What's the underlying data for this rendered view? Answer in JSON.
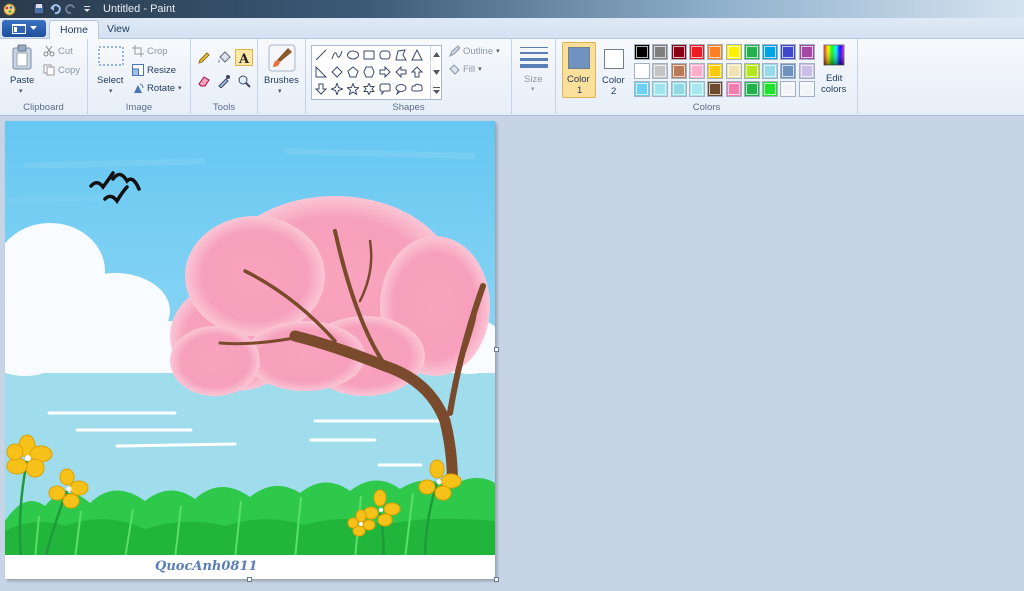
{
  "window": {
    "title": "Untitled - Paint"
  },
  "tabs": [
    {
      "label": "Home"
    },
    {
      "label": "View"
    }
  ],
  "clipboard": {
    "paste": "Paste",
    "cut": "Cut",
    "copy": "Copy",
    "group": "Clipboard"
  },
  "image": {
    "select": "Select",
    "crop": "Crop",
    "resize": "Resize",
    "rotate": "Rotate",
    "group": "Image"
  },
  "tools": {
    "group": "Tools"
  },
  "brushes": {
    "label": "Brushes"
  },
  "shapes": {
    "outline": "Outline",
    "fill": "Fill",
    "group": "Shapes"
  },
  "size": {
    "label": "Size"
  },
  "colors": {
    "color1_label": "Color",
    "color1_num": "1",
    "color2_label": "Color",
    "color2_num": "2",
    "edit_label": "Edit",
    "edit_label2": "colors",
    "group": "Colors",
    "color1": "#7092be",
    "color2": "#ffffff",
    "palette": [
      [
        "#000000",
        "#7f7f7f",
        "#880015",
        "#ed1c24",
        "#ff7f27",
        "#fff200",
        "#22b14c",
        "#00a2e8",
        "#3f48cc",
        "#a349a4"
      ],
      [
        "#ffffff",
        "#c3c3c3",
        "#b97a57",
        "#ffaec9",
        "#ffc90e",
        "#efe4b0",
        "#b5e61d",
        "#99d9ea",
        "#7092be",
        "#c8bfe7"
      ],
      [
        "#6fd0f5",
        "#9fe3f0",
        "#8fd8e6",
        "#a6e7f2",
        "#6e4a2e",
        "#f07cb0",
        "#22b14c",
        "#1fe32a",
        "#f2f4f7",
        "#f2f4f7"
      ]
    ]
  },
  "canvas": {
    "signature": "QuocAnh0811"
  }
}
